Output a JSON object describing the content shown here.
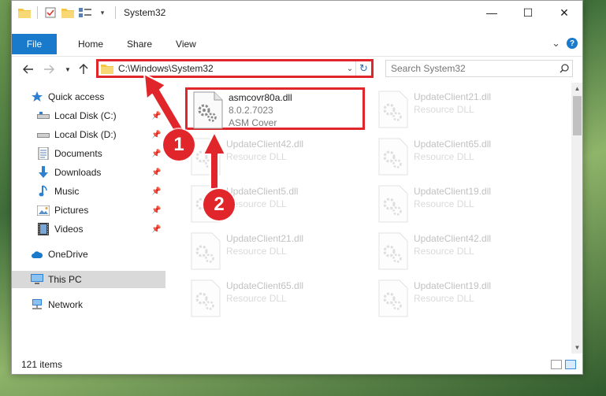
{
  "window": {
    "title": "System32",
    "controls": {
      "minimize": "—",
      "maximize": "☐",
      "close": "✕"
    }
  },
  "ribbon": {
    "tabs": [
      "File",
      "Home",
      "Share",
      "View"
    ],
    "expand": "⌄",
    "help": "?"
  },
  "address": {
    "path": "C:\\Windows\\System32",
    "search_placeholder": "Search System32"
  },
  "sidebar": {
    "items": [
      {
        "label": "Quick access",
        "icon": "star-icon",
        "pinned": false
      },
      {
        "label": "Local Disk (C:)",
        "icon": "drive-icon",
        "pinned": true
      },
      {
        "label": "Local Disk (D:)",
        "icon": "drive-icon",
        "pinned": true
      },
      {
        "label": "Documents",
        "icon": "documents-icon",
        "pinned": true
      },
      {
        "label": "Downloads",
        "icon": "download-icon",
        "pinned": true
      },
      {
        "label": "Music",
        "icon": "music-icon",
        "pinned": true
      },
      {
        "label": "Pictures",
        "icon": "pictures-icon",
        "pinned": true
      },
      {
        "label": "Videos",
        "icon": "videos-icon",
        "pinned": true
      },
      {
        "label": "OneDrive",
        "icon": "cloud-icon",
        "pinned": false
      },
      {
        "label": "This PC",
        "icon": "computer-icon",
        "pinned": false,
        "selected": true
      },
      {
        "label": "Network",
        "icon": "network-icon",
        "pinned": false
      }
    ]
  },
  "files": [
    {
      "name": "asmcovr80a.dll",
      "line1": "8.0.2.7023",
      "line2": "ASM Cover",
      "highlight": true
    },
    {
      "name": "UpdateClient21.dll",
      "line1": "Resource DLL"
    },
    {
      "name": "UpdateClient42.dll",
      "line1": "Resource DLL"
    },
    {
      "name": "UpdateClient65.dll",
      "line1": "Resource DLL"
    },
    {
      "name": "UpdateClient5.dll",
      "line1": "Resource DLL"
    },
    {
      "name": "UpdateClient19.dll",
      "line1": "Resource DLL"
    },
    {
      "name": "UpdateClient21.dll",
      "line1": "Resource DLL"
    },
    {
      "name": "UpdateClient42.dll",
      "line1": "Resource DLL"
    },
    {
      "name": "UpdateClient65.dll",
      "line1": "Resource DLL"
    },
    {
      "name": "UpdateClient19.dll",
      "line1": "Resource DLL"
    }
  ],
  "status": {
    "count": "121 items"
  },
  "annotations": [
    {
      "label": "1"
    },
    {
      "label": "2"
    }
  ],
  "colors": {
    "accent": "#1979ca",
    "highlight": "#e0262a",
    "selection": "#d9d9d9"
  }
}
